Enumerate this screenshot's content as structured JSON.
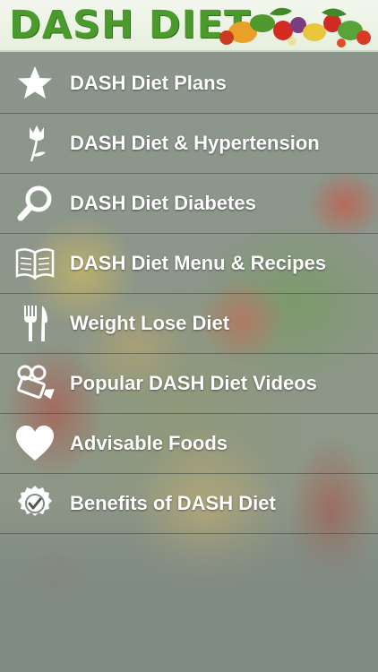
{
  "header": {
    "title": "DASH DIET"
  },
  "menu": {
    "items": [
      {
        "label": "DASH Diet Plans",
        "icon": "star-icon"
      },
      {
        "label": "DASH Diet & Hypertension",
        "icon": "tulip-icon"
      },
      {
        "label": "DASH Diet Diabetes",
        "icon": "magnifier-icon"
      },
      {
        "label": "DASH Diet Menu & Recipes",
        "icon": "open-book-icon"
      },
      {
        "label": "Weight Lose Diet",
        "icon": "fork-knife-icon"
      },
      {
        "label": "Popular DASH Diet Videos",
        "icon": "video-camera-icon"
      },
      {
        "label": "Advisable Foods",
        "icon": "heart-icon"
      },
      {
        "label": "Benefits of DASH Diet",
        "icon": "check-badge-icon"
      }
    ]
  },
  "colors": {
    "logo_green": "#4a9b2c",
    "menu_text": "#ffffff",
    "overlay": "#7f8a83"
  }
}
